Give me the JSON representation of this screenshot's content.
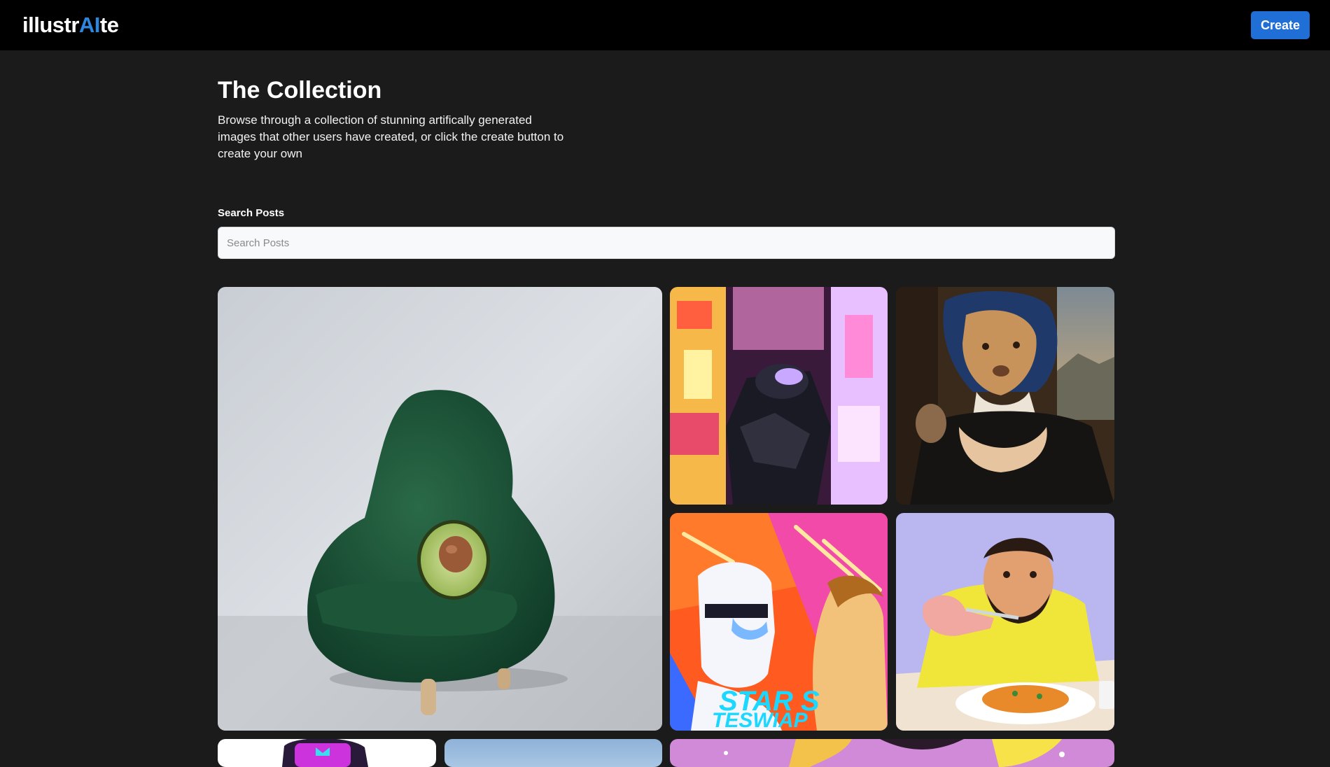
{
  "header": {
    "logo_prefix": "illustr",
    "logo_ai": "AI",
    "logo_suffix": "te",
    "create_label": "Create"
  },
  "hero": {
    "title": "The Collection",
    "description": "Browse through a collection of stunning artifically generated images that other users have created, or click the create button to create your own"
  },
  "search": {
    "label": "Search Posts",
    "placeholder": "Search Posts",
    "value": ""
  },
  "gallery": {
    "items": [
      {
        "name": "avocado-armchair",
        "icon": "image"
      },
      {
        "name": "neon-robot-city",
        "icon": "image"
      },
      {
        "name": "dog-portrait-painting",
        "icon": "image"
      },
      {
        "name": "stormtrooper-comic",
        "icon": "image"
      },
      {
        "name": "man-eating-pasta",
        "icon": "image"
      },
      {
        "name": "purple-cartoon",
        "icon": "image"
      },
      {
        "name": "blue-sky",
        "icon": "image"
      },
      {
        "name": "pink-abstract",
        "icon": "image"
      }
    ]
  },
  "colors": {
    "accent": "#1f6fd6",
    "ai_text": "#2f86de",
    "background": "#1b1b1b",
    "topbar": "#000000"
  }
}
